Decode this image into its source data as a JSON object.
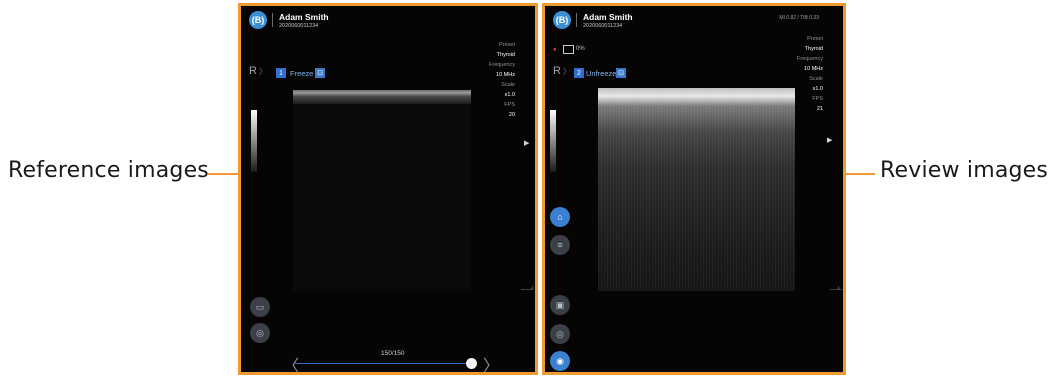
{
  "labels": {
    "left": "Reference images",
    "right": "Review images"
  },
  "colors": {
    "frame": "#f29a32",
    "accent": "#2e6fd0",
    "background": "#070404"
  },
  "left_panel": {
    "logo": "(B)",
    "patient_name": "Adam Smith",
    "patient_id": "2020060011234",
    "params": [
      {
        "key": "Preset",
        "value": "Thyroid"
      },
      {
        "key": "Frequency",
        "value": "10 MHz"
      },
      {
        "key": "Scale",
        "value": "x1.0"
      },
      {
        "key": "FPS",
        "value": "20"
      }
    ],
    "side_label": "R",
    "image_number": "1",
    "mode": "Freeze",
    "mode_icon": "lock-icon",
    "frame_counter": "150/150",
    "frame_progress": 1.0,
    "depth_label": "4",
    "buttons": [
      "caliper-icon",
      "camera-icon"
    ]
  },
  "right_panel": {
    "logo": "(B)",
    "patient_name": "Adam Smith",
    "patient_id": "2020060011234",
    "top_right_info": "MI 0.82 / TIB 0.33",
    "recording_percent": "0%",
    "params": [
      {
        "key": "Preset",
        "value": "Thyroid"
      },
      {
        "key": "Frequency",
        "value": "10 MHz"
      },
      {
        "key": "Scale",
        "value": "x1.0"
      },
      {
        "key": "FPS",
        "value": "21"
      }
    ],
    "side_label": "R",
    "image_number": "2",
    "mode": "Unfreeze",
    "mode_icon": "lock-icon",
    "depth_label": "4",
    "buttons": [
      "probe-icon",
      "menu-icon",
      "video-camera-icon",
      "camera-icon",
      "capture-icon"
    ]
  }
}
